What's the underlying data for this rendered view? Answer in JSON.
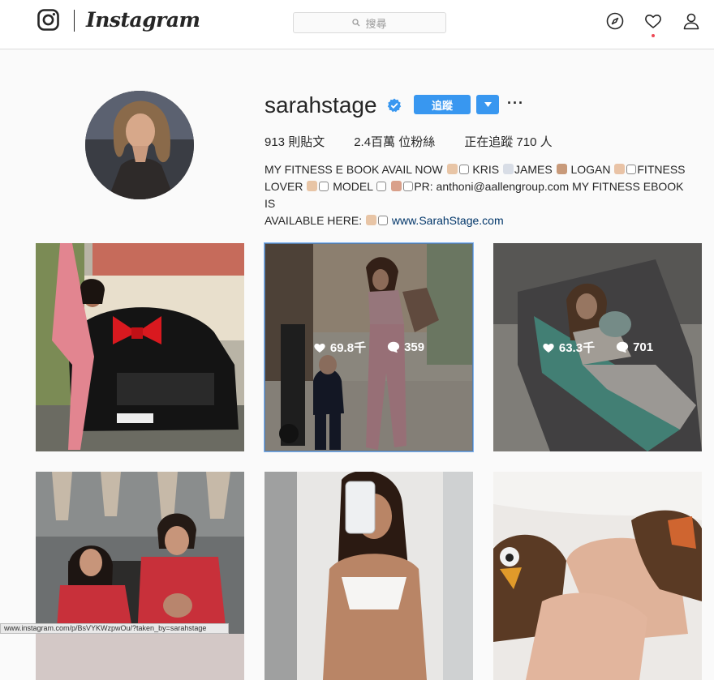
{
  "nav": {
    "wordmark": "Instagram",
    "search_placeholder": "搜尋",
    "icons": [
      "instagram-glyph-icon",
      "compass-icon",
      "heart-icon",
      "person-icon",
      "search-icon"
    ],
    "notification_color": "#ed4956"
  },
  "profile": {
    "username": "sarahstage",
    "verified": true,
    "follow_label": "追蹤",
    "more_label": "···",
    "stats": {
      "posts": "913 則貼文",
      "followers": "2.4百萬 位粉絲",
      "following": "正在追蹤 710 人"
    },
    "bio": {
      "line1": [
        "MY FITNESS E BOOK AVAIL NOW",
        "KRIS",
        "JAMES",
        "LOGAN",
        "FITNESS"
      ],
      "line2": [
        "LOVER",
        "MODEL",
        "PR: anthoni@aallengroup.com MY FITNESS EBOOK IS"
      ],
      "line3": "AVAILABLE HERE:",
      "link": "www.SarahStage.com"
    },
    "accent_color": "#3897f0"
  },
  "posts": [
    {
      "likes": "",
      "comments": ""
    },
    {
      "likes": "69.8千",
      "comments": "359"
    },
    {
      "likes": "63.3千",
      "comments": "701"
    },
    {
      "likes": "",
      "comments": ""
    },
    {
      "likes": "",
      "comments": ""
    },
    {
      "likes": "",
      "comments": ""
    }
  ],
  "status_bar": "www.instagram.com/p/BsVYKWzpwOu/?taken_by=sarahstage"
}
